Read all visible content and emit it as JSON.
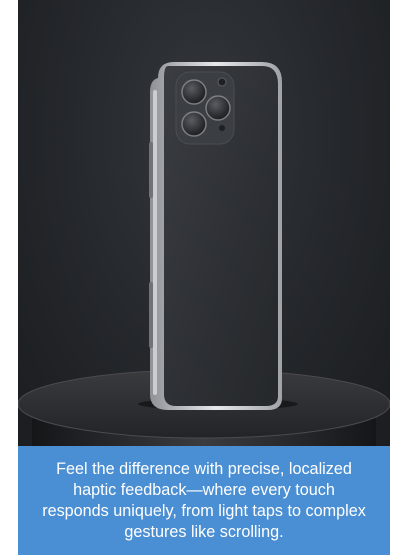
{
  "image": {
    "alt": "",
    "icon": "phone-product-photo"
  },
  "caption": {
    "text": "Feel the difference with precise, localized haptic feedback—where every touch responds uniquely, from light taps to complex gestures like scrolling."
  },
  "colors": {
    "caption_bg": "#4a8ed3",
    "caption_text": "#ffffff",
    "photo_bg": "#25282c",
    "phone_body": "#2f3236",
    "frame": "#c9ccd0",
    "pedestal": "#2b2c2f"
  }
}
